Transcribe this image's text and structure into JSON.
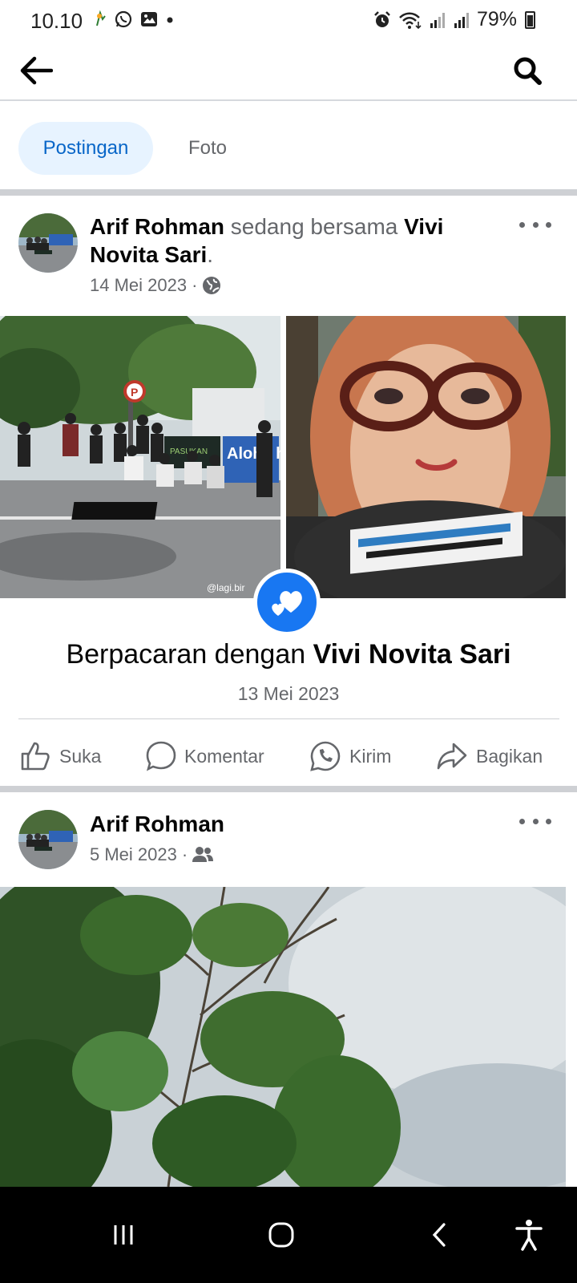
{
  "status_bar": {
    "time": "10.10",
    "battery": "79%"
  },
  "tabs": [
    {
      "label": "Postingan",
      "active": true
    },
    {
      "label": "Foto",
      "active": false
    }
  ],
  "post1": {
    "author": "Arif Rohman",
    "with_text": "sedang bersama",
    "tagged": "Vivi Novita Sari",
    "punct": ".",
    "date": "14 Mei 2023",
    "photo_watermark": "@lagi.bir",
    "event_prefix": "Berpacaran dengan",
    "event_name": "Vivi Novita Sari",
    "event_date": "13 Mei 2023",
    "banner_text": "Aloha horror",
    "banner_text_2": "PASUKAN"
  },
  "actions": {
    "like": "Suka",
    "comment": "Komentar",
    "send": "Kirim",
    "share": "Bagikan"
  },
  "post2": {
    "author": "Arif Rohman",
    "date": "5 Mei 2023"
  },
  "icons": {
    "back": "arrow-left-icon",
    "search": "search-icon",
    "globe": "globe-icon",
    "friends": "friends-icon",
    "heart": "hearts-icon"
  },
  "colors": {
    "accent": "#1877f2",
    "tab_active_bg": "#e7f3ff",
    "tab_active_text": "#0866c8",
    "secondary_text": "#65676b"
  }
}
